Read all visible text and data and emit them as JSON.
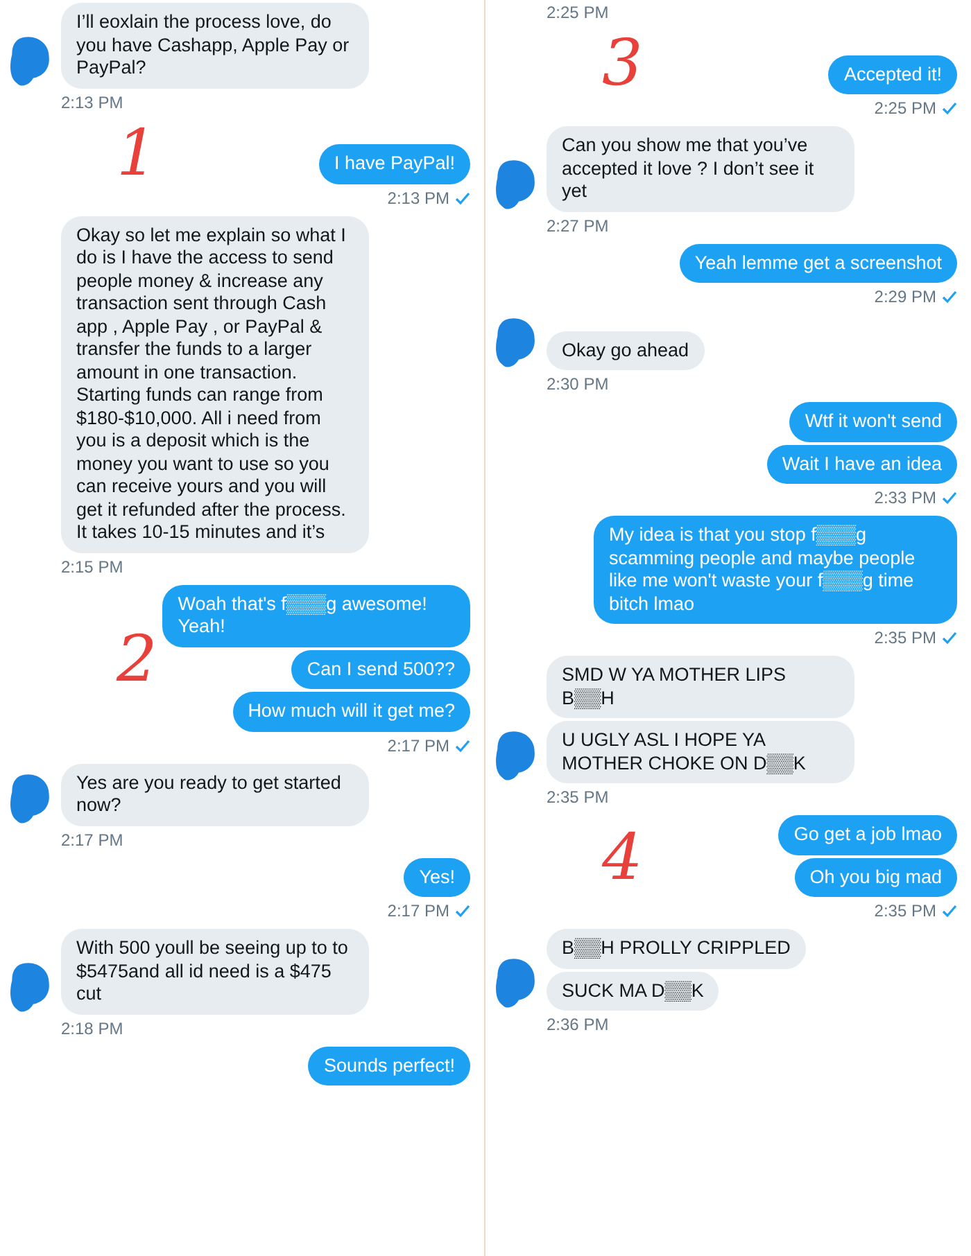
{
  "columns": [
    {
      "screenshots": [
        {
          "groups": [
            {
              "kind": "received",
              "avatar": true,
              "bubbles": [
                "I’ll eoxlain the process love, do you have Cashapp, Apple Pay or PayPal?"
              ],
              "time": "2:13 PM"
            },
            {
              "kind": "sent",
              "annotation": "1",
              "bubbles": [
                "I have PayPal!"
              ],
              "time": "2:13 PM",
              "read": true
            },
            {
              "kind": "received",
              "bubbles": [
                "Okay so let me explain so what I do is I have the access to send people money & increase any transaction sent through Cash app , Apple Pay , or PayPal  & transfer the funds to a larger amount in one transaction. Starting funds can range from $180-$10,000. All i need from you is a deposit which is the money you want to use so you can receive yours and you will get it refunded after the process. It takes 10-15 minutes and it’s"
              ],
              "time": "2:15 PM"
            }
          ]
        },
        {
          "groups": [
            {
              "kind": "sent",
              "annotation": "2",
              "bubbles": [
                "Woah that's f▒▒▒g awesome! Yeah!",
                "Can I send 500??",
                "How much will it get me?"
              ],
              "time": "2:17 PM",
              "read": true
            },
            {
              "kind": "received",
              "avatar": true,
              "bubbles": [
                "Yes are you ready to get started now?"
              ],
              "time": "2:17 PM"
            },
            {
              "kind": "sent",
              "bubbles": [
                "Yes!"
              ],
              "time": "2:17 PM",
              "read": true
            },
            {
              "kind": "received",
              "avatar": true,
              "bubbles": [
                "With 500 youll be seeing up to to $5475and all id need is a $475 cut"
              ],
              "time": "2:18 PM"
            },
            {
              "kind": "sent",
              "bubbles": [
                "Sounds perfect!"
              ]
            }
          ]
        }
      ]
    },
    {
      "screenshots": [
        {
          "groups": [
            {
              "kind": "received",
              "time": "2:25 PM"
            },
            {
              "kind": "sent",
              "annotation": "3",
              "bubbles": [
                "Accepted it!"
              ],
              "time": "2:25 PM",
              "read": true
            },
            {
              "kind": "received",
              "avatar": true,
              "bubbles": [
                "Can you show me that you’ve accepted it love ? I don’t see it yet"
              ],
              "time": "2:27 PM"
            },
            {
              "kind": "sent",
              "bubbles": [
                "Yeah lemme get a screenshot"
              ],
              "time": "2:29 PM",
              "read": true
            },
            {
              "kind": "received",
              "avatar": true,
              "bubbles": [
                "Okay go ahead"
              ],
              "time": "2:30 PM"
            },
            {
              "kind": "sent",
              "bubbles": [
                "Wtf it won't send",
                "Wait I have an idea"
              ],
              "time": "2:33 PM",
              "read": true
            }
          ]
        },
        {
          "groups": [
            {
              "kind": "sent",
              "bubbles": [
                "My idea is that you stop f▒▒▒g scamming people and maybe people like me won't waste your f▒▒▒g time bitch lmao"
              ],
              "time": "2:35 PM",
              "read": true
            },
            {
              "kind": "received",
              "avatar": true,
              "bubbles": [
                "SMD W YA MOTHER LIPS B▒▒H",
                "U UGLY ASL I HOPE YA MOTHER CHOKE ON D▒▒K"
              ],
              "time": "2:35 PM"
            },
            {
              "kind": "sent",
              "annotation": "4",
              "bubbles": [
                "Go get a job lmao",
                "Oh you big mad"
              ],
              "time": "2:35 PM",
              "read": true
            },
            {
              "kind": "received",
              "avatar": true,
              "bubbles": [
                "B▒▒H PROLLY CRIPPLED",
                "SUCK MA D▒▒K"
              ],
              "time": "2:36 PM"
            }
          ]
        }
      ]
    }
  ]
}
